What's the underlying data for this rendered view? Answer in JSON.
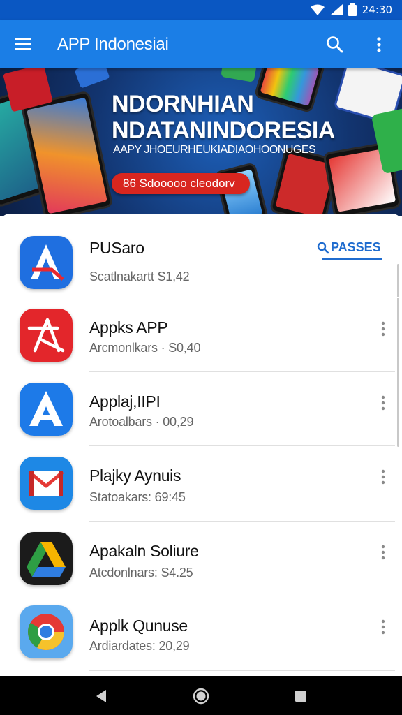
{
  "status_bar": {
    "time": "24:30"
  },
  "app_bar": {
    "title": "APP Indonesiai",
    "icons": [
      "menu-icon",
      "search-icon",
      "more-vert-icon"
    ]
  },
  "banner": {
    "line1": "NDORNHIAN",
    "line2": "NDATANINDORESIA",
    "subtitle": "AAPY JHOEURHEUKIADIAOHOONUGES",
    "cta": "86 Sdooooo cleodorv"
  },
  "featured": {
    "button_label": "PASSES",
    "button_icon": "search-icon"
  },
  "apps": [
    {
      "name": "PUSaro",
      "meta": "Scatlnakartt  S1,42",
      "icon": "blue-a-icon"
    },
    {
      "name": "Appks APP",
      "meta": "Arcmonlkars · S0,40",
      "icon": "red-a-icon"
    },
    {
      "name": "Applaj,IIPI",
      "meta": "Arotoalbars · 00,29",
      "icon": "white-a-icon"
    },
    {
      "name": "Plajky Aynuis",
      "meta": "Statoakars: 69:45",
      "icon": "mail-icon"
    },
    {
      "name": "Apakaln Soliure",
      "meta": "Atcdonlnars: S4.25",
      "icon": "drive-icon"
    },
    {
      "name": "Applk Qunuse",
      "meta": "Ardiardates: 20,29",
      "icon": "chrome-icon"
    }
  ],
  "colors": {
    "status_bar": "#0a57c2",
    "app_bar": "#1b7ee6",
    "accent": "#1f6ccf",
    "cta": "#d8261f"
  },
  "nav_bar": {
    "icons": [
      "back-icon",
      "home-icon",
      "recents-icon"
    ]
  }
}
